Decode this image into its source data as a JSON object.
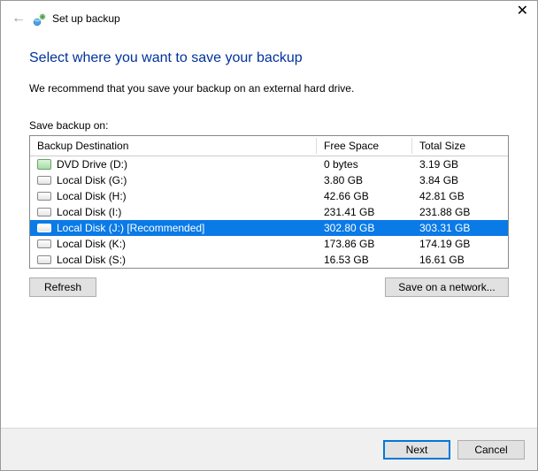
{
  "titlebar": {
    "title": "Set up backup"
  },
  "content": {
    "heading": "Select where you want to save your backup",
    "description": "We recommend that you save your backup on an external hard drive.",
    "list_label": "Save backup on:"
  },
  "table": {
    "headers": {
      "destination": "Backup Destination",
      "free": "Free Space",
      "total": "Total Size"
    },
    "rows": [
      {
        "icon": "dvd",
        "name": "DVD Drive (D:)",
        "free": "0 bytes",
        "total": "3.19 GB",
        "selected": false
      },
      {
        "icon": "disk",
        "name": "Local Disk (G:)",
        "free": "3.80 GB",
        "total": "3.84 GB",
        "selected": false
      },
      {
        "icon": "disk",
        "name": "Local Disk (H:)",
        "free": "42.66 GB",
        "total": "42.81 GB",
        "selected": false
      },
      {
        "icon": "disk",
        "name": "Local Disk (I:)",
        "free": "231.41 GB",
        "total": "231.88 GB",
        "selected": false
      },
      {
        "icon": "disk",
        "name": "Local Disk (J:) [Recommended]",
        "free": "302.80 GB",
        "total": "303.31 GB",
        "selected": true
      },
      {
        "icon": "disk",
        "name": "Local Disk (K:)",
        "free": "173.86 GB",
        "total": "174.19 GB",
        "selected": false
      },
      {
        "icon": "disk",
        "name": "Local Disk (S:)",
        "free": "16.53 GB",
        "total": "16.61 GB",
        "selected": false
      }
    ]
  },
  "buttons": {
    "refresh": "Refresh",
    "network": "Save on a network...",
    "next": "Next",
    "cancel": "Cancel"
  }
}
